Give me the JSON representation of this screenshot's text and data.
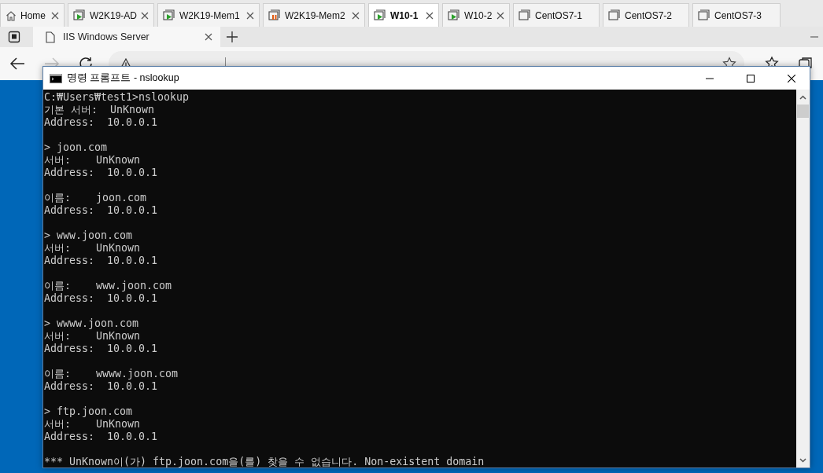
{
  "vm_tabs": [
    {
      "label": "Home",
      "kind": "home",
      "selected": false,
      "closable": true
    },
    {
      "label": "W2K19-AD",
      "kind": "running",
      "selected": false,
      "closable": true
    },
    {
      "label": "W2K19-Mem1",
      "kind": "running",
      "selected": false,
      "closable": true
    },
    {
      "label": "W2K19-Mem2",
      "kind": "paused",
      "selected": false,
      "closable": true
    },
    {
      "label": "W10-1",
      "kind": "running",
      "selected": true,
      "closable": true
    },
    {
      "label": "W10-2",
      "kind": "running",
      "selected": false,
      "closable": true
    },
    {
      "label": "CentOS7-1",
      "kind": "stopped",
      "selected": false,
      "closable": false
    },
    {
      "label": "CentOS7-2",
      "kind": "stopped",
      "selected": false,
      "closable": false
    },
    {
      "label": "CentOS7-3",
      "kind": "stopped",
      "selected": false,
      "closable": false
    }
  ],
  "browser": {
    "tab": {
      "title": "IIS Windows Server"
    },
    "nav": [
      {
        "kind": "back",
        "disabled": false
      },
      {
        "kind": "forward",
        "disabled": true
      },
      {
        "kind": "refresh",
        "disabled": false
      }
    ]
  },
  "console": {
    "title": "명령 프롬프트 - nslookup",
    "blocks": [
      [
        "C:₩Users₩test1>nslookup",
        "기본 서버:  UnKnown",
        "Address:  10.0.0.1"
      ],
      [
        "> joon.com",
        "서버:    UnKnown",
        "Address:  10.0.0.1"
      ],
      [
        "이름:    joon.com",
        "Address:  10.0.0.1"
      ],
      [
        "> www.joon.com",
        "서버:    UnKnown",
        "Address:  10.0.0.1"
      ],
      [
        "이름:    www.joon.com",
        "Address:  10.0.0.1"
      ],
      [
        "> wwww.joon.com",
        "서버:    UnKnown",
        "Address:  10.0.0.1"
      ],
      [
        "이름:    wwww.joon.com",
        "Address:  10.0.0.1"
      ],
      [
        "> ftp.joon.com",
        "서버:    UnKnown",
        "Address:  10.0.0.1"
      ],
      [
        "*** UnKnown이(가) ftp.joon.com을(를) 찾을 수 없습니다. Non-existent domain"
      ]
    ]
  }
}
